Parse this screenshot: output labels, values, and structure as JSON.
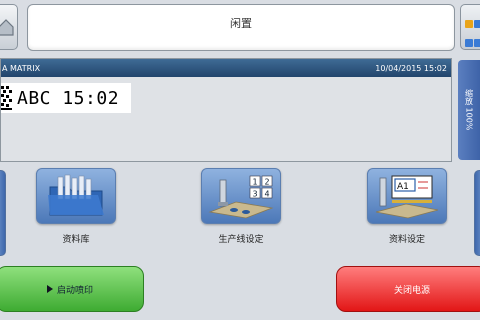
{
  "status": {
    "text": "闲置"
  },
  "message": {
    "title": "A MATRIX",
    "datetime": "10/04/2015  15:02",
    "content_text": "ABC 15:02"
  },
  "zoom": {
    "label": "缩放 100%"
  },
  "tiles": [
    {
      "label": "资料库",
      "icon": "folder-database-icon"
    },
    {
      "label": "生产线设定",
      "icon": "production-line-icon"
    },
    {
      "label": "资料设定",
      "icon": "data-setting-icon"
    }
  ],
  "buttons": {
    "start_label": "启动喷印",
    "power_label": "关闭电源"
  },
  "colors": {
    "header_blue": "#2f5a85",
    "start_green": "#4cbf3c",
    "power_red": "#f02828",
    "tile_blue": "#6f98d0"
  }
}
